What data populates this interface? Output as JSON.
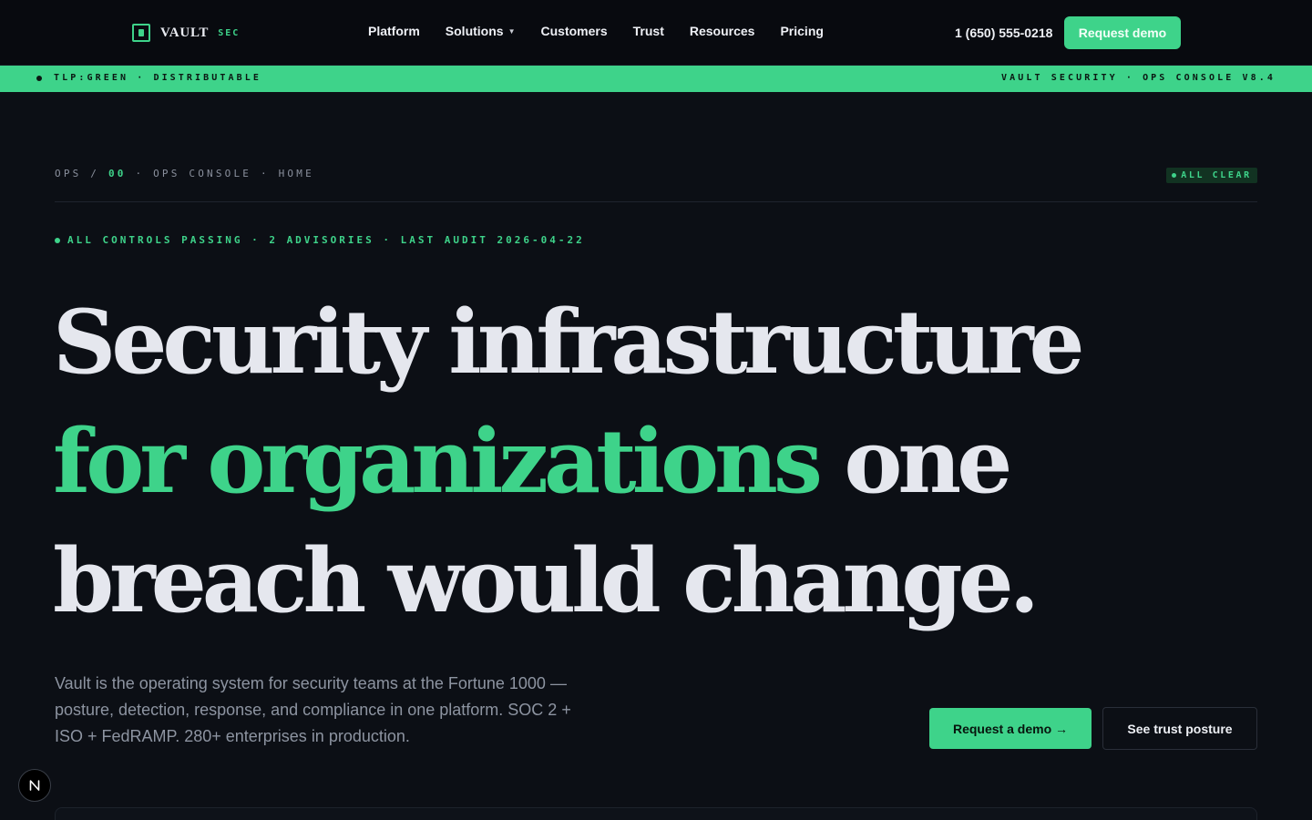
{
  "nav": {
    "logo_text": "VAULT",
    "logo_sub": "SEC",
    "items": [
      {
        "label": "Platform"
      },
      {
        "label": "Solutions",
        "has_dropdown": true
      },
      {
        "label": "Customers"
      },
      {
        "label": "Trust"
      },
      {
        "label": "Resources"
      },
      {
        "label": "Pricing"
      }
    ],
    "phone": "1 (650) 555-0218",
    "cta": "Request demo"
  },
  "ribbon": {
    "left": "TLP:GREEN · DISTRIBUTABLE",
    "right": "VAULT SECURITY · OPS CONSOLE V8.4"
  },
  "breadcrumb": {
    "prefix": "OPS /",
    "index": "00",
    "rest": "· OPS CONSOLE · HOME"
  },
  "badge": {
    "label": "ALL CLEAR"
  },
  "status": {
    "text": "ALL CONTROLS PASSING · 2 ADVISORIES · LAST AUDIT 2026-04-22"
  },
  "hero": {
    "line1": "Security infrastructure",
    "line2_accent": "for organizations",
    "line2_rest": "one",
    "line3": "breach would change.",
    "description": "Vault is the operating system for security teams at the Fortune 1000 — posture, detection, response, and compliance in one platform. SOC 2 + ISO + FedRAMP. 280+ enterprises in production.",
    "primary_cta": "Request a demo →",
    "secondary_cta": "See trust posture"
  },
  "colors": {
    "accent": "#3ed38a",
    "background": "#0c0f15",
    "nav_background": "#080a0f",
    "text": "#e5e7ee",
    "muted": "#8d94a1"
  },
  "icons": {
    "logo": "vault-logo-icon",
    "dropdown": "chevron-down-icon",
    "fab": "next-js-icon"
  }
}
